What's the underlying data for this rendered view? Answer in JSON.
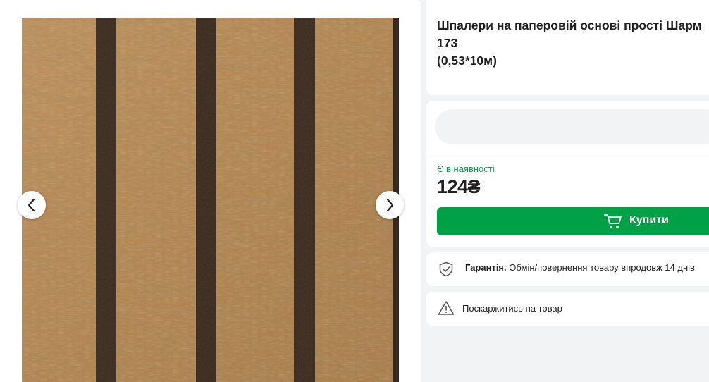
{
  "product": {
    "title": "Шпалери на паперовій основі прості Шарм 173\n(0,53*10м)"
  },
  "gallery": {
    "prev_icon": "chevron-left-icon",
    "next_icon": "chevron-right-icon"
  },
  "purchase": {
    "availability": "Є в наявності",
    "price": "124",
    "currency": "₴",
    "buy_label": "Купити",
    "buy_icon": "cart-icon"
  },
  "warranty": {
    "label": "Гарантія.",
    "text": "Обмін/повернення товару впродовж 14 днів"
  },
  "complaint": {
    "label": "Поскаржитись на товар",
    "icon": "warning-icon"
  },
  "colors": {
    "accent_green": "#00a046",
    "page_bg": "#f2f3f5",
    "text": "#221f1f"
  }
}
